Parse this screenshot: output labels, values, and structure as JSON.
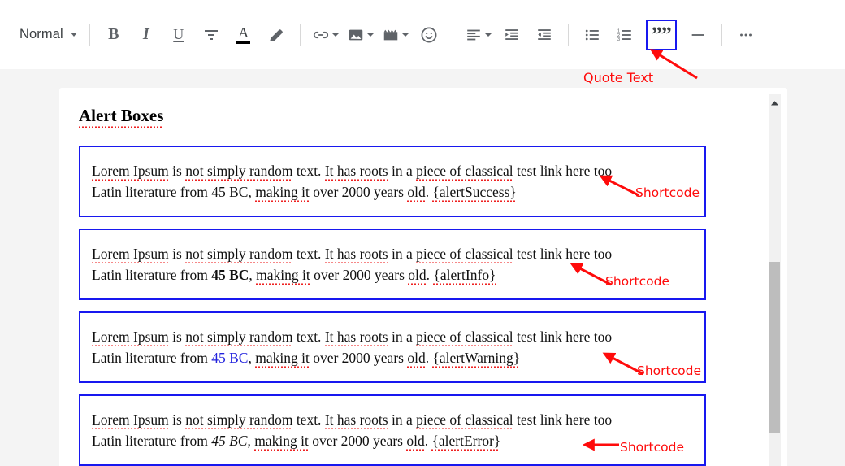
{
  "toolbar": {
    "style_dropdown": {
      "value": "Normal",
      "name": "paragraph-style-select"
    },
    "buttons": [
      {
        "id": "bold",
        "label": "B",
        "icon": "bold-icon"
      },
      {
        "id": "italic",
        "label": "I",
        "icon": "italic-icon"
      },
      {
        "id": "underline",
        "label": "U",
        "icon": "underline-icon"
      },
      {
        "id": "strikethrough",
        "label": "",
        "icon": "strikethrough-icon"
      },
      {
        "id": "text-color",
        "label": "A",
        "icon": "text-color-icon"
      },
      {
        "id": "highlight",
        "label": "",
        "icon": "highlight-pen-icon"
      },
      {
        "id": "link",
        "label": "",
        "icon": "link-icon"
      },
      {
        "id": "image",
        "label": "",
        "icon": "image-icon"
      },
      {
        "id": "video",
        "label": "",
        "icon": "video-icon"
      },
      {
        "id": "emoji",
        "label": "",
        "icon": "emoji-icon"
      },
      {
        "id": "align",
        "label": "",
        "icon": "align-left-icon"
      },
      {
        "id": "indent-increase",
        "label": "",
        "icon": "indent-increase-icon"
      },
      {
        "id": "indent-decrease",
        "label": "",
        "icon": "indent-decrease-icon"
      },
      {
        "id": "bullet-list",
        "label": "",
        "icon": "bulleted-list-icon"
      },
      {
        "id": "numbered-list",
        "label": "",
        "icon": "numbered-list-icon"
      },
      {
        "id": "blockquote",
        "label": "””",
        "icon": "quote-icon",
        "active": true
      },
      {
        "id": "horizontal-rule",
        "label": "",
        "icon": "horizontal-rule-icon"
      },
      {
        "id": "more",
        "label": "",
        "icon": "more-options-icon"
      }
    ],
    "text_color_swatch": "#000000"
  },
  "document": {
    "title": "Alert Boxes",
    "alerts": [
      {
        "shortcode": "{alertSuccess}",
        "line1_a": "Lorem Ipsum",
        "line1_b": " is ",
        "line1_c": "not simply random",
        "line1_d": " text. ",
        "line1_e": "It has roots",
        "line1_f": " in a ",
        "line1_g": "piece of classical",
        "line1_h": " test link here too",
        "line2_a": "Latin literature from ",
        "line2_date": "45 BC",
        "line2_b": ", ",
        "line2_c": "making it",
        "line2_d": " over 2000 years ",
        "line2_e": "old",
        "line2_f": ". ",
        "date_style": "underline"
      },
      {
        "shortcode": "{alertInfo}",
        "line1_a": "Lorem Ipsum",
        "line1_b": " is ",
        "line1_c": "not simply random",
        "line1_d": " text. ",
        "line1_e": "It has roots",
        "line1_f": " in a ",
        "line1_g": "piece of classical",
        "line1_h": " test link here too",
        "line2_a": "Latin literature from ",
        "line2_date": "45 BC",
        "line2_b": ", ",
        "line2_c": "making it",
        "line2_d": " over 2000 years ",
        "line2_e": "old",
        "line2_f": ". ",
        "date_style": "bold"
      },
      {
        "shortcode": "{alertWarning}",
        "line1_a": "Lorem Ipsum",
        "line1_b": " is ",
        "line1_c": "not simply random",
        "line1_d": " text. ",
        "line1_e": "It has roots",
        "line1_f": " in a ",
        "line1_g": "piece of classical",
        "line1_h": " test link here too",
        "line2_a": "Latin literature from ",
        "line2_date": "45 BC",
        "line2_b": ", ",
        "line2_c": "making it",
        "line2_d": " over 2000 years ",
        "line2_e": "old",
        "line2_f": ". ",
        "date_style": "link"
      },
      {
        "shortcode": "{alertError}",
        "line1_a": "Lorem Ipsum",
        "line1_b": " is ",
        "line1_c": "not simply random",
        "line1_d": " text. ",
        "line1_e": "It has roots",
        "line1_f": " in a ",
        "line1_g": "piece of classical",
        "line1_h": " test link here too",
        "line2_a": "Latin literature from ",
        "line2_date": "45 BC",
        "line2_b": ", ",
        "line2_c": "making it",
        "line2_d": " over 2000 years ",
        "line2_e": "old",
        "line2_f": ". ",
        "date_style": "italic"
      }
    ]
  },
  "annotations": {
    "quote_text": "Quote Text",
    "shortcode_1": "Shortcode",
    "shortcode_2": "Shortcode",
    "shortcode_3": "Shortcode",
    "shortcode_4": "Shortcode",
    "color": "#ff0b0b"
  },
  "colors": {
    "alert_border": "#1818ef",
    "active_button_border": "#1818ef",
    "link": "#2222dd",
    "spellcheck_underline": "#ee2222",
    "page_background": "#f4f4f4",
    "scrollbar_thumb": "#bdbdbd"
  }
}
